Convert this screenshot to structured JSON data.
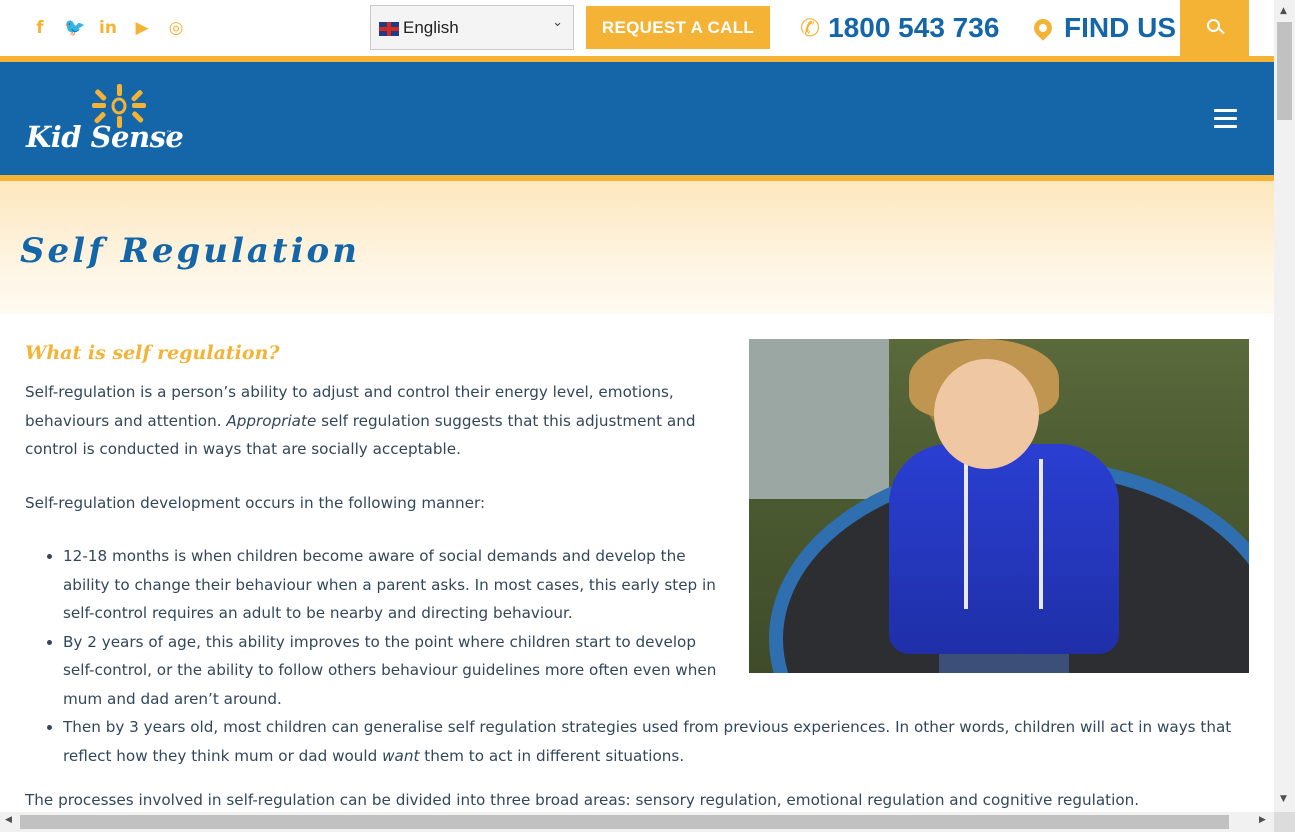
{
  "topbar": {
    "social": [
      {
        "name": "facebook-icon",
        "glyph": "f"
      },
      {
        "name": "twitter-icon",
        "glyph": "🐦"
      },
      {
        "name": "linkedin-icon",
        "glyph": "in"
      },
      {
        "name": "youtube-icon",
        "glyph": "▶"
      },
      {
        "name": "instagram-icon",
        "glyph": "◎"
      }
    ],
    "language": "English",
    "request_call": "REQUEST A CALL",
    "phone": "1800 543 736",
    "find_us": "FIND US"
  },
  "header": {
    "logo_text": "Kid Sense",
    "logo_tm": "™"
  },
  "banner": {
    "title": "Self Regulation"
  },
  "content": {
    "heading": "What is self regulation?",
    "p1_a": "Self-regulation is a person’s ability to adjust and control their energy level, emotions, behaviours and attention. ",
    "p1_em": "Appropriate",
    "p1_b": " self regulation suggests that this adjustment and control is conducted in ways that are socially  acceptable.",
    "p2": "Self-regulation development occurs in the following manner:",
    "bullets": [
      "12-18 months is when children become aware of social demands and develop the ability to change their behaviour when a parent asks. In most cases, this early step in self-control requires an adult to be nearby and directing behaviour.",
      "By 2 years of age, this ability improves to the point where children start to develop self-control, or the ability to follow others behaviour guidelines more often even when mum and dad aren’t around."
    ],
    "bullet3_a": "Then by 3 years old, most children can generalise self regulation strategies used from previous experiences. In other words, children will act in ways that reflect how they think mum or dad would ",
    "bullet3_em": "want",
    "bullet3_b": " them to act in different situations.",
    "p3": "The processes involved in self-regulation can be divided into three broad areas: sensory regulation, emotional regulation and cognitive regulation."
  },
  "colors": {
    "brand_blue": "#1566a8",
    "accent_yellow": "#f5b335",
    "body_text": "#33475b"
  }
}
